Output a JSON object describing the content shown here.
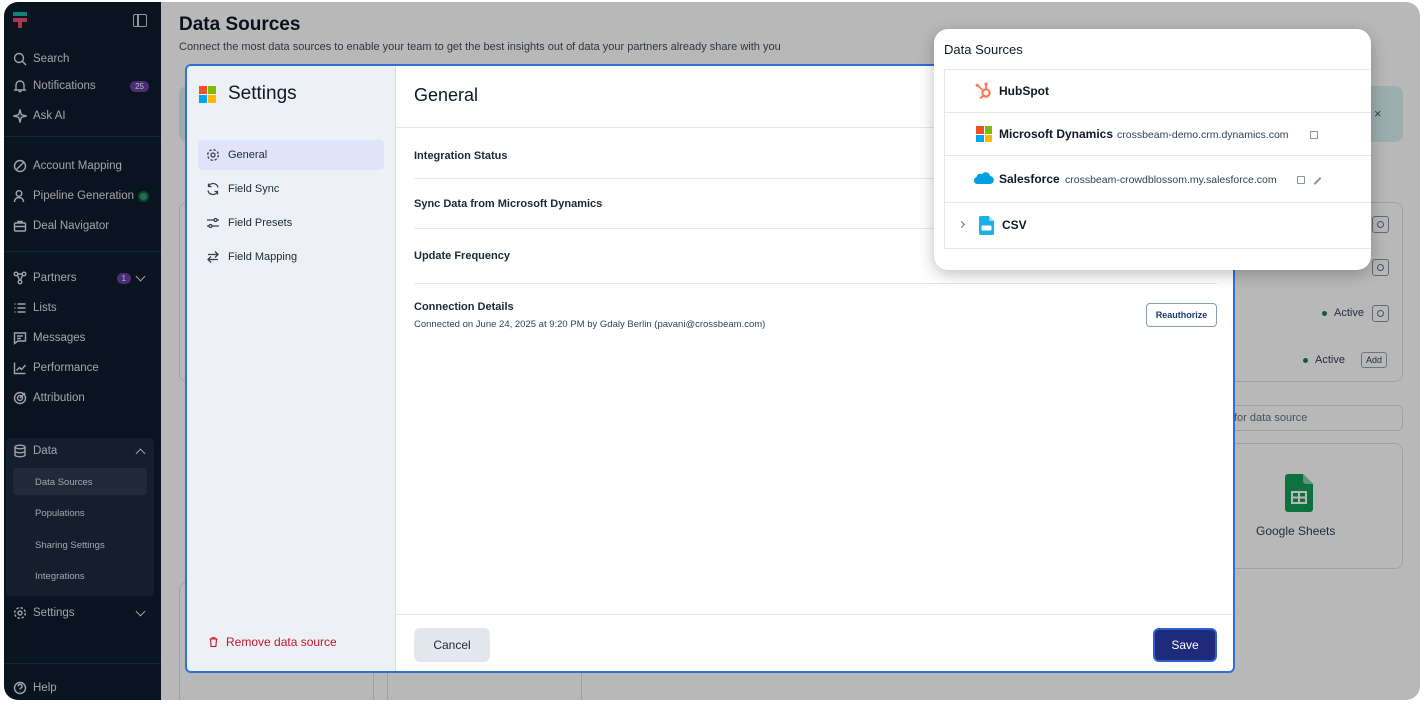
{
  "sidebar": {
    "items": [
      {
        "label": "Search",
        "icon": "search-icon"
      },
      {
        "label": "Notifications",
        "icon": "bell-icon",
        "badge": "25"
      },
      {
        "label": "Ask AI",
        "icon": "sparkle-icon"
      },
      {
        "label": "Account Mapping",
        "icon": "mapping-icon"
      },
      {
        "label": "Pipeline Generation",
        "icon": "user-icon"
      },
      {
        "label": "Deal Navigator",
        "icon": "briefcase-icon"
      },
      {
        "label": "Partners",
        "icon": "network-icon",
        "badge": "1"
      },
      {
        "label": "Lists",
        "icon": "list-icon"
      },
      {
        "label": "Messages",
        "icon": "message-icon"
      },
      {
        "label": "Performance",
        "icon": "chart-icon"
      },
      {
        "label": "Attribution",
        "icon": "target-icon"
      }
    ],
    "data_group": {
      "label": "Data",
      "children": [
        "Data Sources",
        "Populations",
        "Sharing Settings",
        "Integrations"
      ]
    },
    "settings_label": "Settings",
    "help_label": "Help"
  },
  "page": {
    "title": "Data Sources",
    "subtitle": "Connect the most data sources to enable your team to get the best insights out of data your partners already share with you",
    "bg_status_1": "Active",
    "bg_status_2": "Active",
    "bg_add": "Add",
    "bg_search_placeholder": "for data source",
    "bg_google_sheets": "Google Sheets",
    "bg_close": "×"
  },
  "modal": {
    "title": "Settings",
    "tabs": [
      "General",
      "Field Sync",
      "Field Presets",
      "Field Mapping"
    ],
    "remove_label": "Remove data source",
    "section_title": "General",
    "rows": {
      "integration_status": "Integration Status",
      "sync_data": "Sync Data from Microsoft Dynamics",
      "update_frequency": "Update Frequency",
      "connection_details": "Connection Details",
      "connected_on": "Connected on June 24, 2025 at 9:20 PM by Gdaly Berlin (pavani@crossbeam.com)"
    },
    "reauthorize_label": "Reauthorize",
    "cancel_label": "Cancel",
    "save_label": "Save"
  },
  "popup": {
    "title": "Data Sources",
    "sources": [
      {
        "name": "HubSpot",
        "url": ""
      },
      {
        "name": "Microsoft Dynamics",
        "url": "crossbeam-demo.crm.dynamics.com"
      },
      {
        "name": "Salesforce",
        "url": "crossbeam-crowdblossom.my.salesforce.com"
      },
      {
        "name": "CSV",
        "url": ""
      }
    ]
  },
  "colors": {
    "sidebar_bg": "#0f1b2d",
    "accent": "#1e2a7a",
    "danger": "#c0162d",
    "hubspot": "#ff7a59",
    "salesforce": "#00a1e0"
  }
}
